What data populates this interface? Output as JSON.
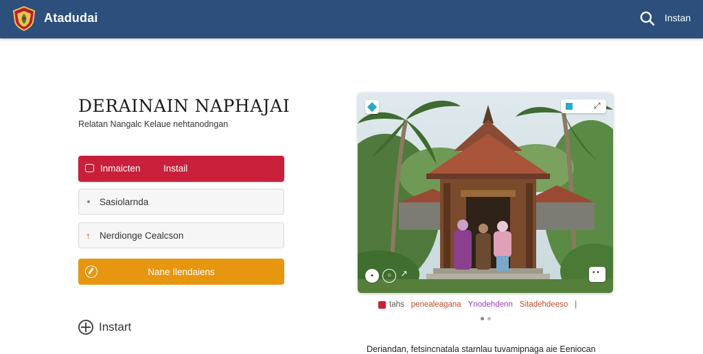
{
  "header": {
    "app_title": "Atadudai",
    "link_label": "Instan",
    "icons": {
      "logo": "crest-logo",
      "search": "search-icon"
    },
    "background": "#2c4f7c"
  },
  "main": {
    "title": "DERAINAIN NAPHAJAI",
    "subtitle": "Relatan Nangalc Kelaue nehtanodngan",
    "buttons": {
      "install_prefix": "Inmaicten",
      "install_label": "Instail",
      "option1_label": "Sasiolarnda",
      "option2_label": "Nerdionge Cealcson",
      "cta_label": "Nane Ilendaiens"
    },
    "install_link": "Instart"
  },
  "gallery": {
    "captions": [
      "tahs",
      "penealeagana",
      "Ynodehdenn",
      "Sitadehdeeso",
      "|"
    ],
    "bottom_text": "Deriandan, fetsincnatala starnlau tuvamipnaga aie Eeniocan"
  },
  "colors": {
    "primary_red": "#c8203a",
    "accent_orange": "#e6960f",
    "header_blue": "#2c4f7c"
  }
}
